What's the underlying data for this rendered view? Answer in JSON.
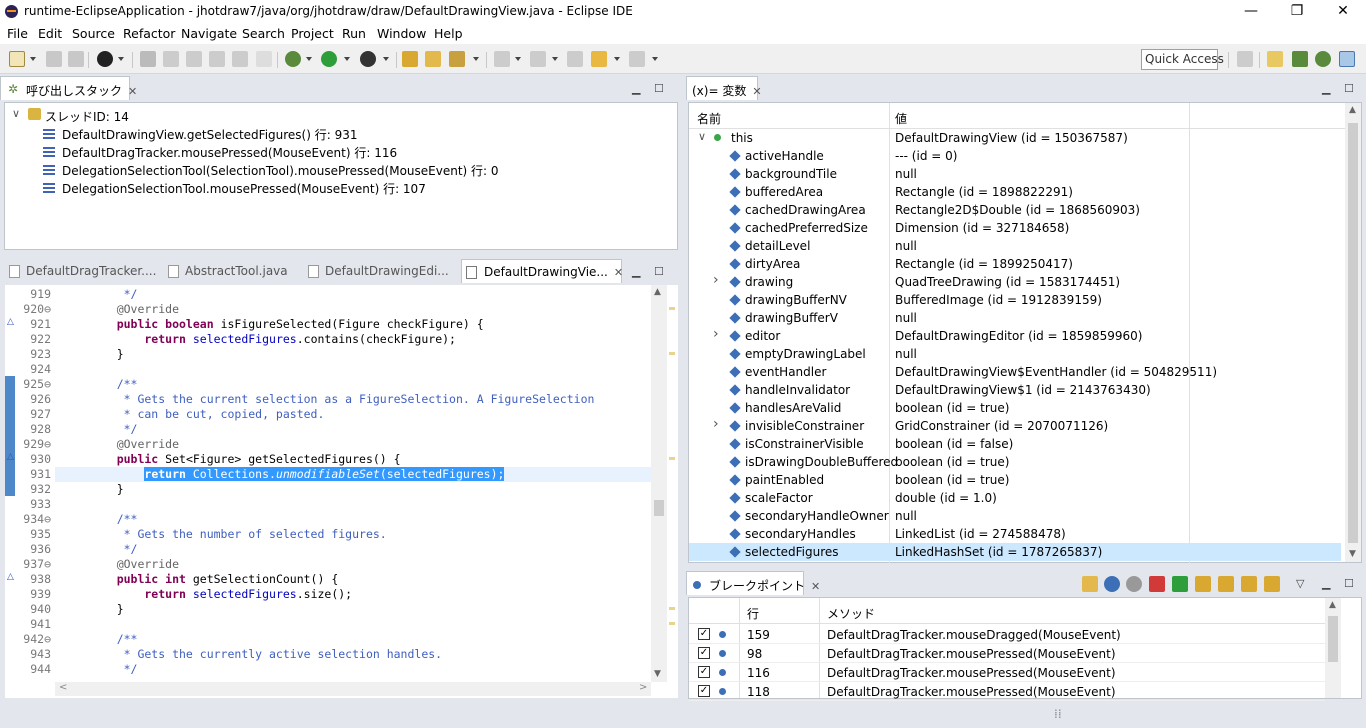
{
  "window": {
    "title": "runtime-EclipseApplication - jhotdraw7/java/org/jhotdraw/draw/DefaultDrawingView.java - Eclipse IDE",
    "minimize": "—",
    "restore": "❐",
    "close": "✕"
  },
  "menu": [
    "File",
    "Edit",
    "Source",
    "Refactor",
    "Navigate",
    "Search",
    "Project",
    "Run",
    "Window",
    "Help"
  ],
  "toolbar": {
    "quick_access": "Quick Access"
  },
  "callstack": {
    "tab_label": "呼び出しスタック",
    "thread": "スレッドID: 14",
    "frames": [
      "DefaultDrawingView.getSelectedFigures() 行: 931",
      "DefaultDragTracker.mousePressed(MouseEvent) 行: 116",
      "DelegationSelectionTool(SelectionTool).mousePressed(MouseEvent) 行: 0",
      "DelegationSelectionTool.mousePressed(MouseEvent) 行: 107"
    ]
  },
  "editor": {
    "tabs": [
      "DefaultDragTracker....",
      "AbstractTool.java",
      "DefaultDrawingEdi...",
      "DefaultDrawingVie..."
    ],
    "lines": [
      {
        "n": "919",
        "t": [
          [
            "cm",
            "     */"
          ]
        ]
      },
      {
        "n": "920⊖",
        "t": [
          [
            "an",
            "    @Override"
          ]
        ]
      },
      {
        "n": "921",
        "ov": true,
        "t": [
          [
            "kw",
            "    public boolean "
          ],
          [
            "",
            "isFigureSelected(Figure checkFigure) {"
          ]
        ]
      },
      {
        "n": "922",
        "t": [
          [
            "kw",
            "        return "
          ],
          [
            "fld",
            "selectedFigures"
          ],
          [
            "",
            ".contains(checkFigure);"
          ]
        ]
      },
      {
        "n": "923",
        "t": [
          [
            "",
            "    }"
          ]
        ]
      },
      {
        "n": "924",
        "t": [
          [
            "",
            ""
          ]
        ]
      },
      {
        "n": "925⊖",
        "t": [
          [
            "cm",
            "    /**"
          ]
        ]
      },
      {
        "n": "926",
        "t": [
          [
            "cm",
            "     * Gets the current selection as a FigureSelection. A FigureSelection"
          ]
        ]
      },
      {
        "n": "927",
        "t": [
          [
            "cm",
            "     * can be cut, copied, pasted."
          ]
        ]
      },
      {
        "n": "928",
        "t": [
          [
            "cm",
            "     */"
          ]
        ]
      },
      {
        "n": "929⊖",
        "t": [
          [
            "an",
            "    @Override"
          ]
        ]
      },
      {
        "n": "930",
        "ov": true,
        "t": [
          [
            "kw",
            "    public "
          ],
          [
            "",
            "Set<Figure> getSelectedFigures() {"
          ]
        ]
      },
      {
        "n": "931",
        "t": [
          [
            "",
            "        "
          ],
          [
            "hl kw",
            "return "
          ],
          [
            "hl",
            "Collections."
          ],
          [
            "hl ital",
            "unmodifiableSet"
          ],
          [
            "hl",
            "(selectedFigures);"
          ]
        ]
      },
      {
        "n": "932",
        "t": [
          [
            "",
            "    }"
          ]
        ]
      },
      {
        "n": "933",
        "t": [
          [
            "",
            ""
          ]
        ]
      },
      {
        "n": "934⊖",
        "t": [
          [
            "cm",
            "    /**"
          ]
        ]
      },
      {
        "n": "935",
        "t": [
          [
            "cm",
            "     * Gets the number of selected figures."
          ]
        ]
      },
      {
        "n": "936",
        "t": [
          [
            "cm",
            "     */"
          ]
        ]
      },
      {
        "n": "937⊖",
        "t": [
          [
            "an",
            "    @Override"
          ]
        ]
      },
      {
        "n": "938",
        "ov": true,
        "t": [
          [
            "kw",
            "    public int "
          ],
          [
            "",
            "getSelectionCount() {"
          ]
        ]
      },
      {
        "n": "939",
        "t": [
          [
            "kw",
            "        return "
          ],
          [
            "fld",
            "selectedFigures"
          ],
          [
            "",
            ".size();"
          ]
        ]
      },
      {
        "n": "940",
        "t": [
          [
            "",
            "    }"
          ]
        ]
      },
      {
        "n": "941",
        "t": [
          [
            "",
            ""
          ]
        ]
      },
      {
        "n": "942⊖",
        "t": [
          [
            "cm",
            "    /**"
          ]
        ]
      },
      {
        "n": "943",
        "t": [
          [
            "cm",
            "     * Gets the currently active selection handles."
          ]
        ]
      },
      {
        "n": "944",
        "t": [
          [
            "cm",
            "     */"
          ]
        ]
      }
    ]
  },
  "variables": {
    "tab_label": "(x)= 変数",
    "col_name": "名前",
    "col_value": "値",
    "root": {
      "name": "this",
      "value": "DefaultDrawingView (id = 150367587)"
    },
    "fields": [
      {
        "name": "activeHandle",
        "value": "--- (id = 0)",
        "exp": false
      },
      {
        "name": "backgroundTile",
        "value": "null",
        "exp": false
      },
      {
        "name": "bufferedArea",
        "value": "Rectangle (id = 1898822291)",
        "exp": false
      },
      {
        "name": "cachedDrawingArea",
        "value": "Rectangle2D$Double (id = 1868560903)",
        "exp": false
      },
      {
        "name": "cachedPreferredSize",
        "value": "Dimension (id = 327184658)",
        "exp": false
      },
      {
        "name": "detailLevel",
        "value": "null",
        "exp": false
      },
      {
        "name": "dirtyArea",
        "value": "Rectangle (id = 1899250417)",
        "exp": false
      },
      {
        "name": "drawing",
        "value": "QuadTreeDrawing (id = 1583174451)",
        "exp": true
      },
      {
        "name": "drawingBufferNV",
        "value": "BufferedImage (id = 1912839159)",
        "exp": false
      },
      {
        "name": "drawingBufferV",
        "value": "null",
        "exp": false
      },
      {
        "name": "editor",
        "value": "DefaultDrawingEditor (id = 1859859960)",
        "exp": true
      },
      {
        "name": "emptyDrawingLabel",
        "value": "null",
        "exp": false
      },
      {
        "name": "eventHandler",
        "value": "DefaultDrawingView$EventHandler (id = 504829511)",
        "exp": false
      },
      {
        "name": "handleInvalidator",
        "value": "DefaultDrawingView$1 (id = 2143763430)",
        "exp": false
      },
      {
        "name": "handlesAreValid",
        "value": "boolean (id = true)",
        "exp": false
      },
      {
        "name": "invisibleConstrainer",
        "value": "GridConstrainer (id = 2070071126)",
        "exp": true
      },
      {
        "name": "isConstrainerVisible",
        "value": "boolean (id = false)",
        "exp": false
      },
      {
        "name": "isDrawingDoubleBuffered",
        "value": "boolean (id = true)",
        "exp": false
      },
      {
        "name": "paintEnabled",
        "value": "boolean (id = true)",
        "exp": false
      },
      {
        "name": "scaleFactor",
        "value": "double (id = 1.0)",
        "exp": false
      },
      {
        "name": "secondaryHandleOwner",
        "value": "null",
        "exp": false
      },
      {
        "name": "secondaryHandles",
        "value": "LinkedList (id = 274588478)",
        "exp": false
      },
      {
        "name": "selectedFigures",
        "value": "LinkedHashSet (id = 1787265837)",
        "exp": false
      }
    ]
  },
  "breakpoints": {
    "tab_label": "ブレークポイント",
    "col_line": "行",
    "col_method": "メソッド",
    "rows": [
      {
        "line": "159",
        "method": "DefaultDragTracker.mouseDragged(MouseEvent)"
      },
      {
        "line": "98",
        "method": "DefaultDragTracker.mousePressed(MouseEvent)"
      },
      {
        "line": "116",
        "method": "DefaultDragTracker.mousePressed(MouseEvent)"
      },
      {
        "line": "118",
        "method": "DefaultDragTracker.mousePressed(MouseEvent)"
      }
    ]
  },
  "colors": {
    "keyword": "#7f0055",
    "comment": "#3f5fbf",
    "field": "#0000c0",
    "selection": "#3399ff"
  }
}
